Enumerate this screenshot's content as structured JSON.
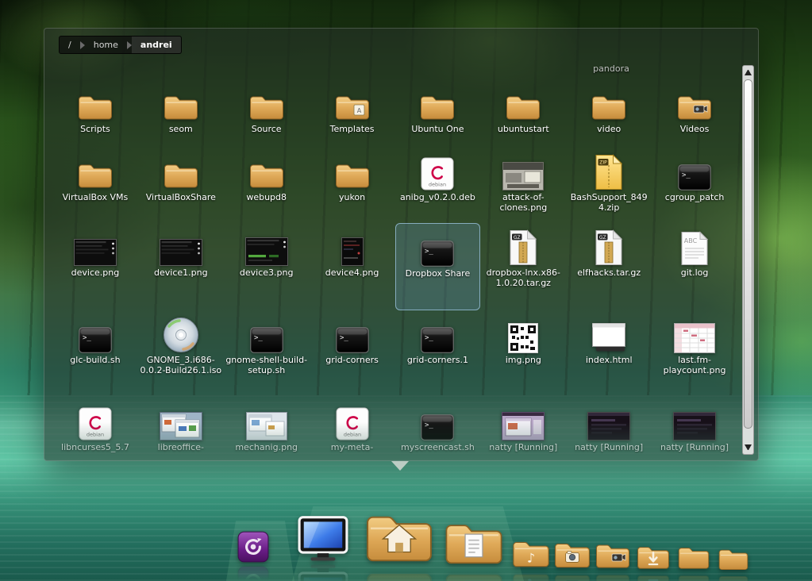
{
  "breadcrumb": {
    "items": [
      "/",
      "home",
      "andrei"
    ]
  },
  "partial_label": "pandora",
  "files": {
    "items": [
      {
        "label": "Scripts",
        "icon": "folder"
      },
      {
        "label": "seom",
        "icon": "folder"
      },
      {
        "label": "Source",
        "icon": "folder"
      },
      {
        "label": "Templates",
        "icon": "folder-templates"
      },
      {
        "label": "Ubuntu One",
        "icon": "folder"
      },
      {
        "label": "ubuntustart",
        "icon": "folder"
      },
      {
        "label": "video",
        "icon": "folder"
      },
      {
        "label": "Videos",
        "icon": "folder-videos"
      },
      {
        "label": "VirtualBox VMs",
        "icon": "folder"
      },
      {
        "label": "VirtualBoxShare",
        "icon": "folder"
      },
      {
        "label": "webupd8",
        "icon": "folder"
      },
      {
        "label": "yukon",
        "icon": "folder"
      },
      {
        "label": "anibg_v0.2.0.deb",
        "icon": "deb"
      },
      {
        "label": "attack-of-clones.png",
        "icon": "photo-gray"
      },
      {
        "label": "BashSupport_8494.zip",
        "icon": "zip"
      },
      {
        "label": "cgroup_patch",
        "icon": "terminal"
      },
      {
        "label": "device.png",
        "icon": "shot-dark-wide"
      },
      {
        "label": "device1.png",
        "icon": "shot-dark-wide"
      },
      {
        "label": "device3.png",
        "icon": "shot-dark-green"
      },
      {
        "label": "device4.png",
        "icon": "shot-dark-small"
      },
      {
        "label": "Dropbox Share",
        "icon": "terminal",
        "selected": true
      },
      {
        "label": "dropbox-lnx.x86-1.0.20.tar.gz",
        "icon": "gz"
      },
      {
        "label": "elfhacks.tar.gz",
        "icon": "gz"
      },
      {
        "label": "git.log",
        "icon": "text"
      },
      {
        "label": "glc-build.sh",
        "icon": "terminal"
      },
      {
        "label": "GNOME_3.i686-0.0.2-Build26.1.iso",
        "icon": "iso"
      },
      {
        "label": "gnome-shell-build-setup.sh",
        "icon": "terminal"
      },
      {
        "label": "grid-corners",
        "icon": "terminal"
      },
      {
        "label": "grid-corners.1",
        "icon": "terminal"
      },
      {
        "label": "img.png",
        "icon": "qr"
      },
      {
        "label": "index.html",
        "icon": "html"
      },
      {
        "label": "last.fm-playcount.png",
        "icon": "sheet"
      },
      {
        "label": "libncurses5_5.7",
        "icon": "deb"
      },
      {
        "label": "libreoffice-",
        "icon": "shot-colorful"
      },
      {
        "label": "mechanig.png",
        "icon": "shot-light"
      },
      {
        "label": "my-meta-",
        "icon": "deb"
      },
      {
        "label": "myscreencast.sh",
        "icon": "terminal"
      },
      {
        "label": "natty [Running]",
        "icon": "vm-light"
      },
      {
        "label": "natty [Running]",
        "icon": "vm-dark"
      },
      {
        "label": "natty [Running]",
        "icon": "vm-dark"
      }
    ]
  },
  "dock": {
    "items": [
      {
        "name": "launcher",
        "icon": "launcher"
      },
      {
        "name": "computer",
        "icon": "monitor"
      },
      {
        "name": "home-folder",
        "icon": "folder-home"
      },
      {
        "name": "documents-folder",
        "icon": "folder-documents"
      },
      {
        "name": "music-folder",
        "icon": "folder-music"
      },
      {
        "name": "pictures-folder",
        "icon": "folder-pictures"
      },
      {
        "name": "videos-folder",
        "icon": "folder-videos-dock"
      },
      {
        "name": "downloads-folder",
        "icon": "folder-downloads"
      },
      {
        "name": "folder-1",
        "icon": "folder-plain"
      },
      {
        "name": "folder-2",
        "icon": "folder-plain"
      }
    ]
  },
  "colors": {
    "selection": "#7fb0d8",
    "folder": "#dca75a",
    "label": "#ffffff",
    "panel": "rgba(36,46,40,0.55)"
  }
}
